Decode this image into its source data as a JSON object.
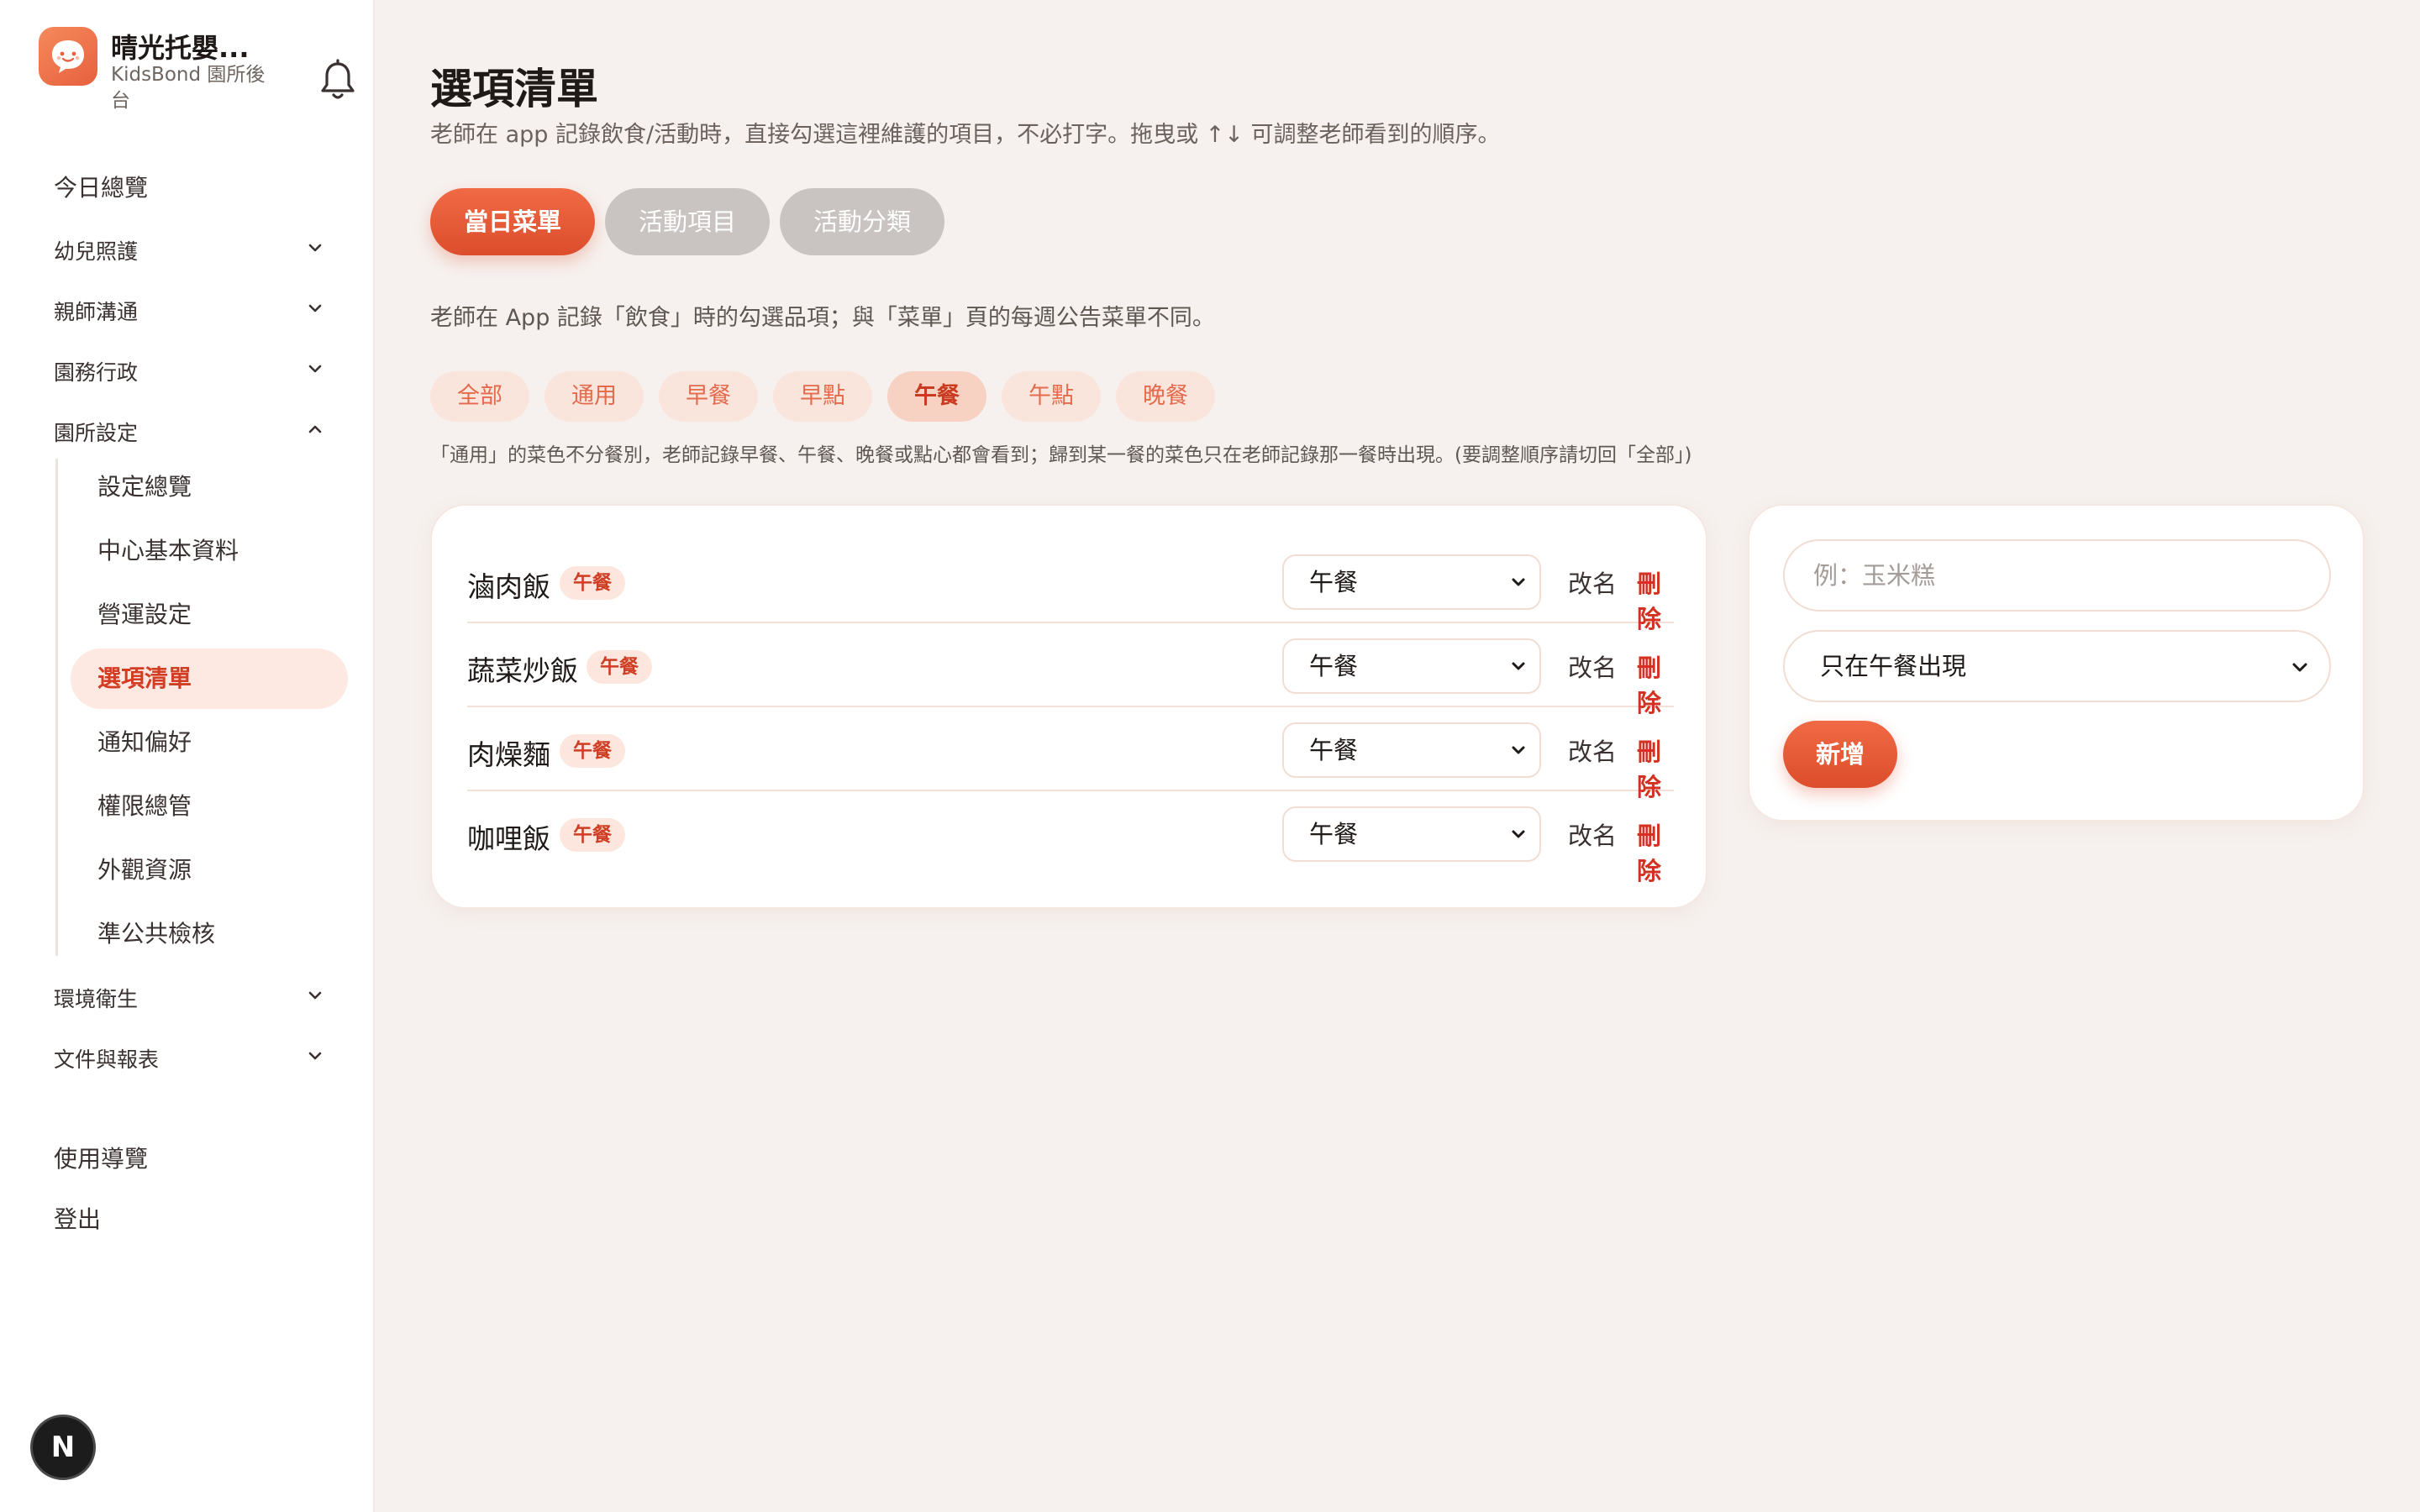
{
  "brand": {
    "name": "晴光托嬰...",
    "subtitle": "KidsBond 園所後台",
    "logo_icon": "chat-bubble-face-icon",
    "accent": "#e8603e"
  },
  "sidebar": {
    "overview": "今日總覽",
    "groups": [
      {
        "label": "幼兒照護",
        "expanded": false
      },
      {
        "label": "親師溝通",
        "expanded": false
      },
      {
        "label": "園務行政",
        "expanded": false
      },
      {
        "label": "園所設定",
        "expanded": true
      }
    ],
    "settings_items": [
      "設定總覽",
      "中心基本資料",
      "營運設定",
      "選項清單",
      "通知偏好",
      "權限總管",
      "外觀資源",
      "準公共檢核"
    ],
    "active_item": "選項清單",
    "lower_groups": [
      {
        "label": "環境衛生",
        "expanded": false
      },
      {
        "label": "文件與報表",
        "expanded": false
      }
    ],
    "guide": "使用導覽",
    "logout": "登出"
  },
  "dev_badge": "N",
  "page": {
    "title": "選項清單",
    "description": "老師在 app 記錄飲食/活動時，直接勾選這裡維護的項目，不必打字。拖曳或 ↑↓ 可調整老師看到的順序。"
  },
  "tabs": [
    {
      "label": "當日菜單",
      "active": true
    },
    {
      "label": "活動項目",
      "active": false
    },
    {
      "label": "活動分類",
      "active": false
    }
  ],
  "section_description": "老師在 App 記錄「飲食」時的勾選品項；與「菜單」頁的每週公告菜單不同。",
  "filters": [
    {
      "label": "全部",
      "active": false
    },
    {
      "label": "通用",
      "active": false
    },
    {
      "label": "早餐",
      "active": false
    },
    {
      "label": "早點",
      "active": false
    },
    {
      "label": "午餐",
      "active": true
    },
    {
      "label": "午點",
      "active": false
    },
    {
      "label": "晚餐",
      "active": false
    }
  ],
  "filter_note": "「通用」的菜色不分餐別，老師記錄早餐、午餐、晚餐或點心都會看到；歸到某一餐的菜色只在老師記錄那一餐時出現。(要調整順序請切回「全部」)",
  "items": [
    {
      "name": "滷肉飯",
      "badge": "午餐",
      "meal": "午餐"
    },
    {
      "name": "蔬菜炒飯",
      "badge": "午餐",
      "meal": "午餐"
    },
    {
      "name": "肉燥麵",
      "badge": "午餐",
      "meal": "午餐"
    },
    {
      "name": "咖哩飯",
      "badge": "午餐",
      "meal": "午餐"
    }
  ],
  "row_actions": {
    "rename": "改名",
    "delete": "刪除"
  },
  "form": {
    "placeholder": "例：玉米糕",
    "scope": "只在午餐出現",
    "submit": "新增"
  }
}
